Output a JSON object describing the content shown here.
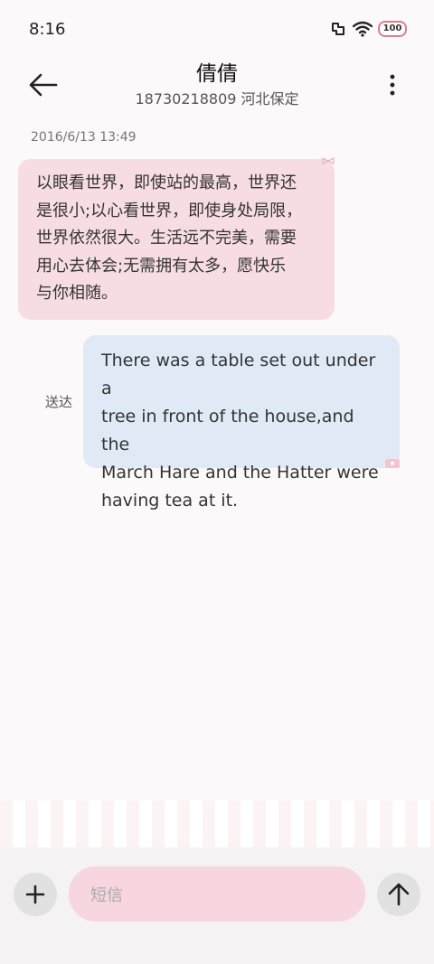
{
  "status_bar": {
    "time": "8:16",
    "battery": "100"
  },
  "header": {
    "contact_name": "倩倩",
    "contact_sub": "18730218809 河北保定"
  },
  "conversation": {
    "timestamp": "2016/6/13 13:49",
    "incoming": {
      "lines": [
        "以眼看世界，即使站的最高，世界还",
        "是很小;以心看世界，即使身处局限，",
        "世界依然很大。生活远不完美，需要",
        "用心去体会;无需拥有太多，愿快乐",
        "与你相随。"
      ]
    },
    "outgoing": {
      "status": "送达",
      "lines": [
        "There was a table set out under a",
        "tree in front of the house,and the",
        "March Hare and the Hatter were",
        "having tea at it."
      ]
    }
  },
  "composer": {
    "placeholder": "短信"
  },
  "icons": {
    "back": "arrow-left-icon",
    "more": "more-vertical-icon",
    "add": "plus-icon",
    "send": "arrow-up-icon"
  },
  "colors": {
    "incoming_bubble": "#f7dde3",
    "outgoing_bubble": "#dfeaf6",
    "input_bg": "#f7d6e0"
  }
}
